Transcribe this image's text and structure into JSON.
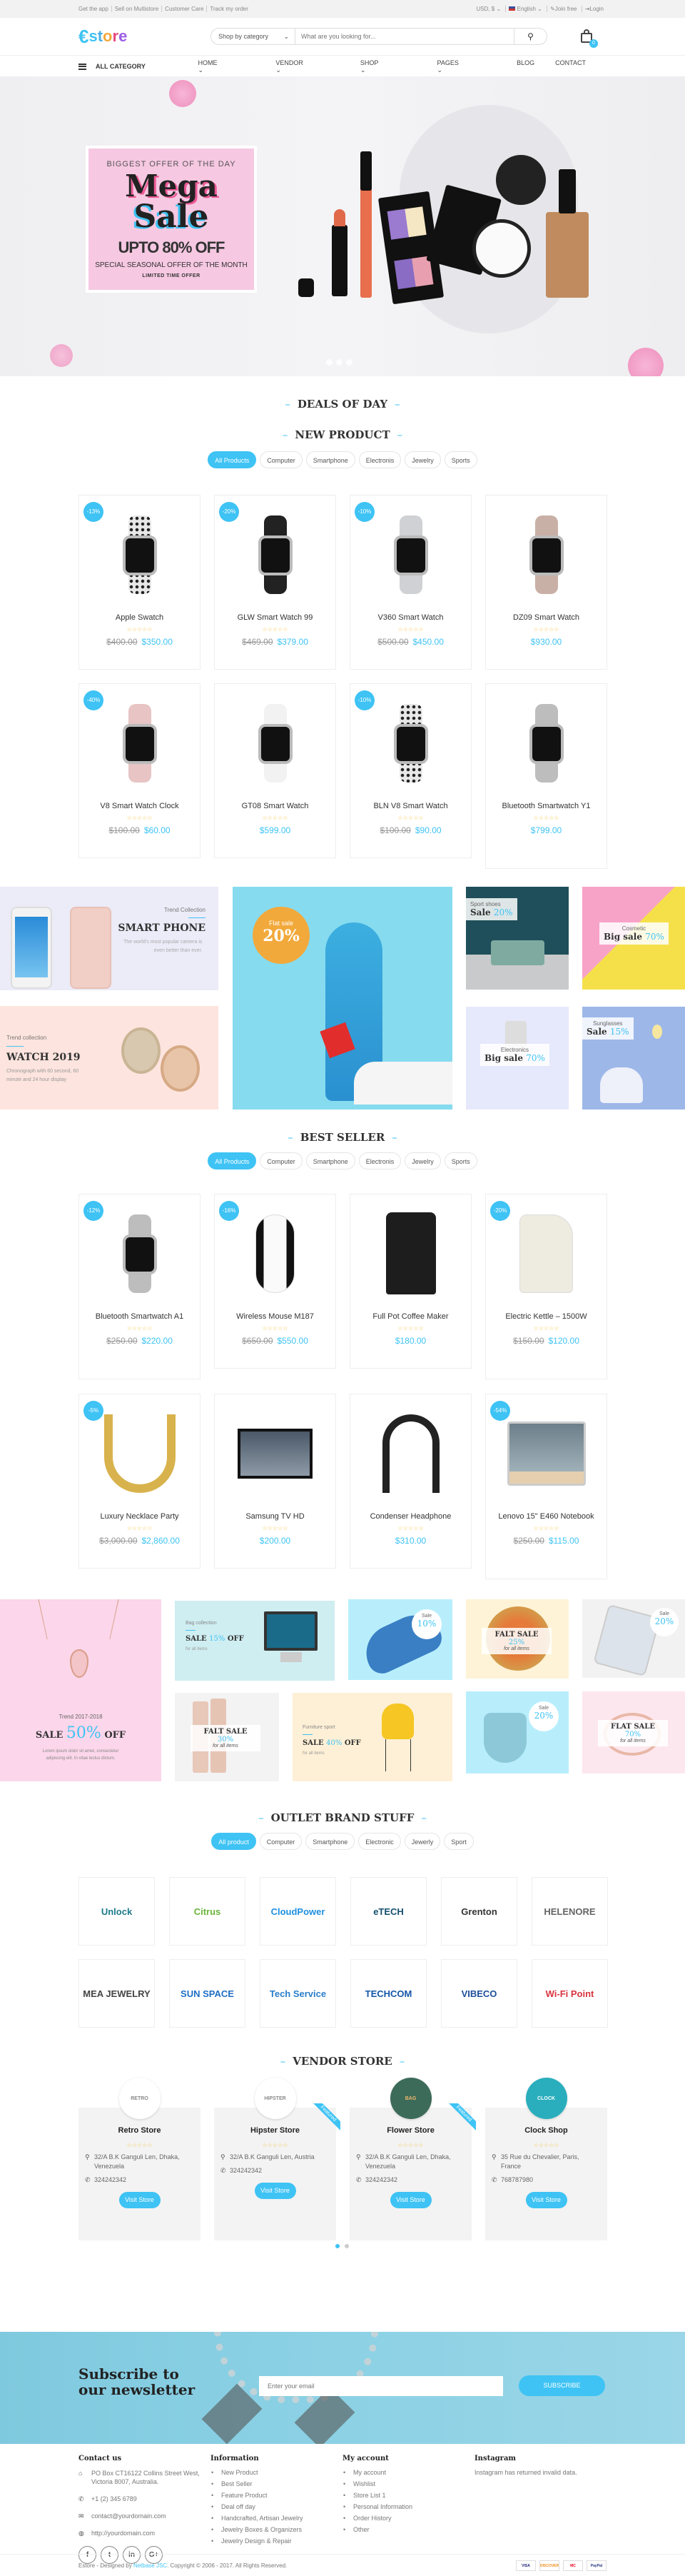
{
  "topbar": {
    "links": [
      "Get the app",
      "Sell on Multistore",
      "Customer Care",
      "Track my order"
    ],
    "currency": "USD, $",
    "language": "English",
    "join": "Join free",
    "login": "Login"
  },
  "header": {
    "logo": {
      "e": "€",
      "letters": [
        "s",
        "t",
        "o",
        "r",
        "e"
      ]
    },
    "search": {
      "category": "Shop by category",
      "placeholder": "What are you looking for..."
    },
    "cart_count": "0"
  },
  "nav": {
    "all_category": "ALL CATEGORY",
    "items": [
      {
        "label": "HOME",
        "dropdown": true
      },
      {
        "label": "VENDOR",
        "dropdown": true
      },
      {
        "label": "SHOP",
        "dropdown": true
      },
      {
        "label": "PAGES",
        "dropdown": true
      },
      {
        "label": "BLOG",
        "dropdown": false
      },
      {
        "label": "CONTACT",
        "dropdown": false
      }
    ]
  },
  "hero": {
    "kicker": "BIGGEST OFFER OF THE DAY",
    "title1": "Mega",
    "title2": "Sale",
    "discount": "UPTO 80% OFF",
    "subtitle": "SPECIAL SEASONAL OFFER OF THE MONTH",
    "note": "LIMITED TIME OFFER",
    "slides": 3
  },
  "deals": {
    "title": "DEALS OF DAY"
  },
  "new_product": {
    "title": "NEW PRODUCT",
    "tabs": [
      "All Products",
      "Computer",
      "Smartphone",
      "Electronis",
      "Jewelry",
      "Sports"
    ],
    "active_tab": 0,
    "products": [
      {
        "name": "Apple Swatch",
        "badge": "-13%",
        "old": "$400.00",
        "price": "$350.00",
        "band": "#e8e8e8",
        "dots": true
      },
      {
        "name": "GLW Smart Watch 99",
        "badge": "-20%",
        "old": "$469.00",
        "price": "$379.00",
        "band": "#222222"
      },
      {
        "name": "V360 Smart Watch",
        "badge": "-10%",
        "old": "$500.00",
        "price": "$450.00",
        "band": "#cfd1d4"
      },
      {
        "name": "DZ09 Smart Watch",
        "badge": "",
        "old": "",
        "price": "$930.00",
        "band": "#c9b0a6"
      },
      {
        "name": "V8 Smart Watch Clock",
        "badge": "-40%",
        "old": "$100.00",
        "price": "$60.00",
        "band": "#e8c4c4"
      },
      {
        "name": "GT08 Smart Watch",
        "badge": "",
        "old": "",
        "price": "$599.00",
        "band": "#f2f2f2"
      },
      {
        "name": "BLN V8 Smart Watch",
        "badge": "-10%",
        "old": "$100.00",
        "price": "$90.00",
        "band": "#e8e8e8",
        "dots": true
      },
      {
        "name": "Bluetooth Smartwatch Y1",
        "badge": "",
        "old": "",
        "price": "$799.00",
        "band": "#bdbdbd"
      }
    ]
  },
  "banners1": {
    "phone": {
      "kicker": "Trend Collection",
      "title": "SMART PHONE",
      "text": "The world's most popular camera is even better than ever."
    },
    "watch": {
      "kicker": "Trend collection",
      "title": "WATCH 2019",
      "text": "Chronograph with 60 second, 60 minute and 24 hour display"
    },
    "fashion": {
      "kicker": "Flat sale",
      "value": "20%"
    },
    "tiles": [
      {
        "kicker": "Sport shoes",
        "label": "Sale",
        "value": "20%"
      },
      {
        "kicker": "Cosmetic",
        "label": "Big sale",
        "value": "70%"
      },
      {
        "kicker": "Electronics",
        "label": "Big sale",
        "value": "70%"
      },
      {
        "kicker": "Sunglasses",
        "label": "Sale",
        "value": "15%"
      }
    ]
  },
  "best_seller": {
    "title": "BEST SELLER",
    "tabs": [
      "All Products",
      "Computer",
      "Smartphone",
      "Electronis",
      "Jewelry",
      "Sports"
    ],
    "active_tab": 0,
    "products": [
      {
        "name": "Bluetooth Smartwatch A1",
        "badge": "-12%",
        "old": "$250.00",
        "price": "$220.00",
        "kind": "watch"
      },
      {
        "name": "Wireless Mouse M187",
        "badge": "-16%",
        "old": "$650.00",
        "price": "$550.00",
        "kind": "mouse"
      },
      {
        "name": "Full Pot Coffee Maker",
        "badge": "",
        "old": "",
        "price": "$180.00",
        "kind": "coffee"
      },
      {
        "name": "Electric Kettle – 1500W",
        "badge": "-20%",
        "old": "$150.00",
        "price": "$120.00",
        "kind": "kettle"
      },
      {
        "name": "Luxury Necklace Party",
        "badge": "-5%",
        "old": "$3,000.00",
        "price": "$2,860.00",
        "kind": "necklace"
      },
      {
        "name": "Samsung TV HD",
        "badge": "",
        "old": "",
        "price": "$200.00",
        "kind": "tv"
      },
      {
        "name": "Condenser Headphone",
        "badge": "",
        "old": "",
        "price": "$310.00",
        "kind": "headphone"
      },
      {
        "name": "Lenovo 15\" E460 Notebook",
        "badge": "-54%",
        "old": "$250.00",
        "price": "$115.00",
        "kind": "laptop"
      }
    ]
  },
  "banners2": {
    "pendant": {
      "kicker": "Trend 2017-2018",
      "sale": "SALE",
      "value": "50%",
      "off": "OFF",
      "text": "Lorem ipsum dolor sit amet, consectetur adipiscing elit. In vitae lectus dictum."
    },
    "bag": {
      "kicker": "Bag collection",
      "sale": "SALE",
      "value": "15%",
      "off": "OFF",
      "note": "for all items"
    },
    "shoe": {
      "label": "Sale",
      "value": "10%"
    },
    "pizza": {
      "label": "FALT SALE",
      "value": "25%",
      "note": "for all items"
    },
    "phone": {
      "label": "Sale",
      "value": "20%"
    },
    "cosmetic": {
      "label": "FALT SALE",
      "value": "30%",
      "note": "for all items"
    },
    "chair": {
      "kicker": "Furniture sport",
      "sale": "SALE",
      "value": "40%",
      "off": "OFF",
      "note": "for all items"
    },
    "purse": {
      "label": "Sale",
      "value": "20%"
    },
    "bracelet": {
      "label": "FLAT SALE",
      "value": "70%",
      "note": "for all items"
    }
  },
  "outlet": {
    "title": "OUTLET BRAND STUFF",
    "tabs": [
      "All product",
      "Computer",
      "Smartphone",
      "Electronic",
      "Jewerly",
      "Sport"
    ],
    "active_tab": 0,
    "brands": [
      {
        "name": "Unlock",
        "color": "#1b7a8a"
      },
      {
        "name": "Citrus",
        "color": "#6bb33a"
      },
      {
        "name": "CloudPower",
        "color": "#1f8fe0"
      },
      {
        "name": "eTECH",
        "color": "#14506e"
      },
      {
        "name": "Grenton",
        "color": "#333333"
      },
      {
        "name": "HELENORE",
        "color": "#666666"
      },
      {
        "name": "MEA JEWELRY",
        "color": "#444444"
      },
      {
        "name": "SUN SPACE",
        "color": "#1f6fc4"
      },
      {
        "name": "Tech Service",
        "color": "#2a7ec8"
      },
      {
        "name": "TECHCOM",
        "color": "#1557a8"
      },
      {
        "name": "VIBECO",
        "color": "#1d4f9c"
      },
      {
        "name": "Wi-Fi Point",
        "color": "#d9343f"
      }
    ]
  },
  "vendors": {
    "title": "VENDOR STORE",
    "button": "Visit Store",
    "featured_label": "Featured",
    "stores": [
      {
        "name": "Retro Store",
        "logo": "RETRO",
        "address": "32/A B.K Ganguli Len, Dhaka, Venezuela",
        "phone": "324242342",
        "featured": false,
        "logo_bg": "#ffffff",
        "logo_fg": "#888888"
      },
      {
        "name": "Hipster Store",
        "logo": "HIPSTER",
        "address": "32/A B.K Ganguli Len, Austria",
        "phone": "324242342",
        "featured": true,
        "logo_bg": "#ffffff",
        "logo_fg": "#888888"
      },
      {
        "name": "Flower Store",
        "logo": "BAG",
        "address": "32/A B.K Ganguli Len, Dhaka, Venezuela",
        "phone": "324242342",
        "featured": true,
        "logo_bg": "#3d6b5a",
        "logo_fg": "#f0b86a"
      },
      {
        "name": "Clock Shop",
        "logo": "CLOCK",
        "address": "35 Rue du Chevalier, Paris, France",
        "phone": "768787980",
        "featured": false,
        "logo_bg": "#2aaebd",
        "logo_fg": "#ffffff"
      }
    ],
    "pages": 2,
    "active_page": 0
  },
  "newsletter": {
    "title": "Subscribe to our newsletter",
    "placeholder": "Enter your email",
    "button": "SUBSCRIBE"
  },
  "footer": {
    "contact": {
      "title": "Contact us",
      "address": "PO Box CT16122 Collins Street West, Victoria 8007, Australia.",
      "phone": "+1 (2) 345 6789",
      "email": "contact@yourdomain.com",
      "website": "http://yourdomain.com",
      "social": [
        "f",
        "t",
        "in",
        "G+"
      ]
    },
    "information": {
      "title": "Information",
      "items": [
        "New Product",
        "Best Seller",
        "Feature Product",
        "Deal off day",
        "Handcrafted, Artisan Jewelry",
        "Jewelry Boxes & Organizers",
        "Jewelry Design & Repair"
      ]
    },
    "account": {
      "title": "My account",
      "items": [
        "My account",
        "Wishlist",
        "Store List 1",
        "Personal Information",
        "Order History",
        "Other"
      ]
    },
    "instagram": {
      "title": "Instagram",
      "text": "Instagram has returned invalid data."
    },
    "copyright_pre": "Estore - Designed by ",
    "copyright_link": "Netbase JSC",
    "copyright_post": ". Copyright © 2006 - 2017. All Rights Reserved.",
    "payments": [
      "VISA",
      "DISCOVER",
      "MC",
      "PayPal"
    ]
  },
  "colors": {
    "accent": "#3ec3f4",
    "star": "#f5c342",
    "orange": "#f2a93b"
  }
}
